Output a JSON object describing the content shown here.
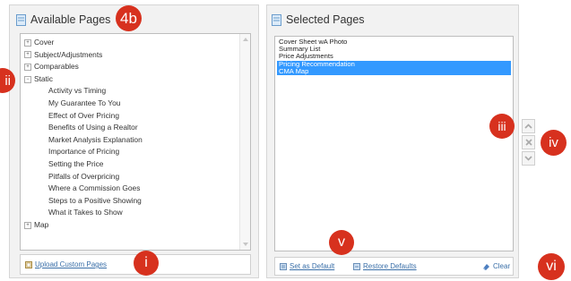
{
  "left_panel": {
    "title": "Available Pages",
    "tree": [
      {
        "label": "Cover",
        "expander": "+"
      },
      {
        "label": "Subject/Adjustments",
        "expander": "+"
      },
      {
        "label": "Comparables",
        "expander": "+"
      },
      {
        "label": "Static",
        "expander": "−"
      },
      {
        "label": "Activity vs Timing"
      },
      {
        "label": "My Guarantee To You"
      },
      {
        "label": "Effect of Over Pricing"
      },
      {
        "label": "Benefits of Using a Realtor"
      },
      {
        "label": "Market Analysis Explanation"
      },
      {
        "label": "Importance of Pricing"
      },
      {
        "label": "Setting the Price"
      },
      {
        "label": "Pitfalls of Overpricing"
      },
      {
        "label": "Where a Commission Goes"
      },
      {
        "label": "Steps to a Positive Showing"
      },
      {
        "label": "What it Takes to Show"
      },
      {
        "label": "Map",
        "expander": "+"
      }
    ],
    "upload_link": "Upload Custom Pages"
  },
  "right_panel": {
    "title": "Selected Pages",
    "items": [
      {
        "label": "Cover Sheet wA Photo",
        "selected": false
      },
      {
        "label": "Summary List",
        "selected": false
      },
      {
        "label": "Price Adjustments",
        "selected": false
      },
      {
        "label": "Pricing Recommendation",
        "selected": true
      },
      {
        "label": "CMA Map",
        "selected": true
      }
    ],
    "set_default": "Set as Default",
    "restore_defaults": "Restore Defaults",
    "clear": "Clear"
  },
  "badges": {
    "b4b": "4b",
    "ii": "ii",
    "iii": "iii",
    "iv": "iv",
    "v": "v",
    "i": "i",
    "vi": "vi"
  },
  "colors": {
    "badge": "#d7311e",
    "highlight": "#3399ff",
    "link": "#3a6fa8"
  }
}
